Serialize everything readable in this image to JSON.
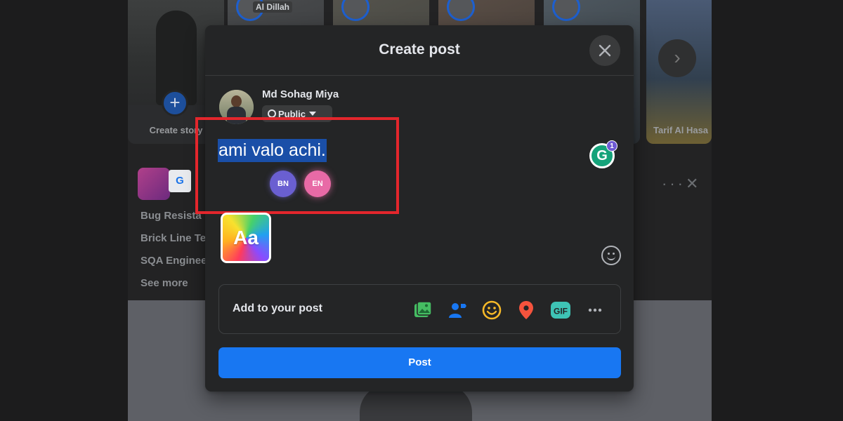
{
  "background": {
    "create_story_label": "Create story",
    "story_tag": "Al Dillah",
    "last_story_name": "Tarif Al Hasa",
    "group_lines": [
      "Bug Resista",
      "Brick Line Te",
      "SQA Enginee",
      "See more"
    ]
  },
  "modal": {
    "title": "Create post",
    "author_name": "Md Sohag Miya",
    "privacy": "Public",
    "post_text": "ami valo achi.",
    "lang_chips": [
      "BN",
      "EN"
    ],
    "grammarly_badge": "1",
    "bg_picker_label": "Aa",
    "add_to_post_label": "Add to your post",
    "post_button": "Post",
    "add_icons": [
      "photo-video-icon",
      "tag-people-icon",
      "feeling-icon",
      "check-in-icon",
      "gif-icon",
      "more-icon"
    ]
  },
  "colors": {
    "accent": "#1877f2",
    "highlight_box": "#e3262c"
  }
}
